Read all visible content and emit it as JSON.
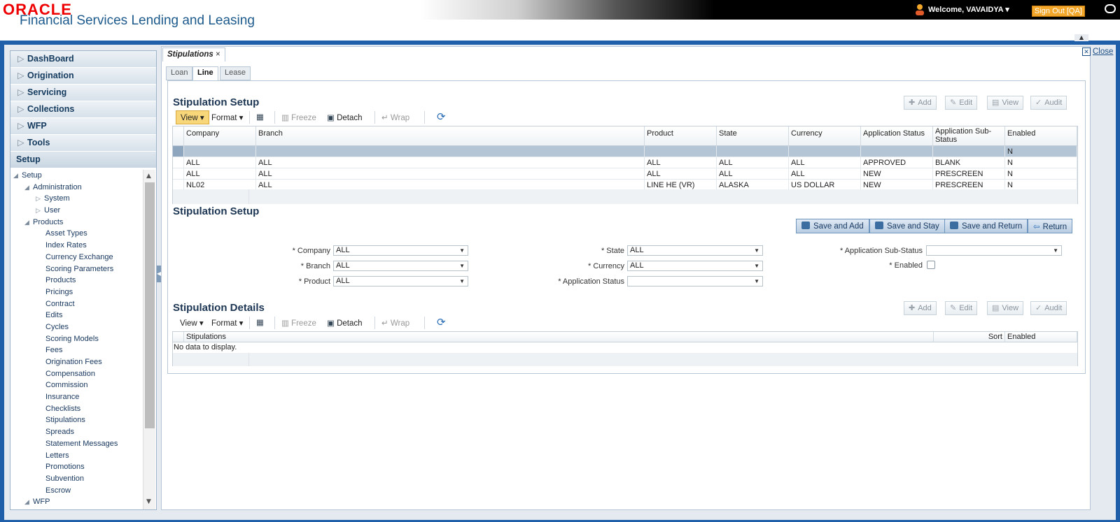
{
  "header": {
    "logo": "ORACLE",
    "product": "Financial Services Lending and Leasing",
    "welcome": "Welcome, VAVAIDYA",
    "signout": "Sign Out [QA]"
  },
  "nav": {
    "items": [
      "DashBoard",
      "Origination",
      "Servicing",
      "Collections",
      "WFP",
      "Tools"
    ],
    "setup": "Setup",
    "tree": [
      {
        "label": "Setup",
        "level": 0,
        "arrow": "◢"
      },
      {
        "label": "Administration",
        "level": 1,
        "arrow": "◢"
      },
      {
        "label": "System",
        "level": 2,
        "arrow": "▷"
      },
      {
        "label": "User",
        "level": 2,
        "arrow": "▷"
      },
      {
        "label": "Products",
        "level": 1,
        "arrow": "◢"
      },
      {
        "label": "Asset Types",
        "level": 3,
        "arrow": ""
      },
      {
        "label": "Index Rates",
        "level": 3,
        "arrow": ""
      },
      {
        "label": "Currency Exchange",
        "level": 3,
        "arrow": ""
      },
      {
        "label": "Scoring Parameters",
        "level": 3,
        "arrow": ""
      },
      {
        "label": "Products",
        "level": 3,
        "arrow": ""
      },
      {
        "label": "Pricings",
        "level": 3,
        "arrow": ""
      },
      {
        "label": "Contract",
        "level": 3,
        "arrow": ""
      },
      {
        "label": "Edits",
        "level": 3,
        "arrow": ""
      },
      {
        "label": "Cycles",
        "level": 3,
        "arrow": ""
      },
      {
        "label": "Scoring Models",
        "level": 3,
        "arrow": ""
      },
      {
        "label": "Fees",
        "level": 3,
        "arrow": ""
      },
      {
        "label": "Origination Fees",
        "level": 3,
        "arrow": ""
      },
      {
        "label": "Compensation",
        "level": 3,
        "arrow": ""
      },
      {
        "label": "Commission",
        "level": 3,
        "arrow": ""
      },
      {
        "label": "Insurance",
        "level": 3,
        "arrow": ""
      },
      {
        "label": "Checklists",
        "level": 3,
        "arrow": ""
      },
      {
        "label": "Stipulations",
        "level": 3,
        "arrow": ""
      },
      {
        "label": "Spreads",
        "level": 3,
        "arrow": ""
      },
      {
        "label": "Statement Messages",
        "level": 3,
        "arrow": ""
      },
      {
        "label": "Letters",
        "level": 3,
        "arrow": ""
      },
      {
        "label": "Promotions",
        "level": 3,
        "arrow": ""
      },
      {
        "label": "Subvention",
        "level": 3,
        "arrow": ""
      },
      {
        "label": "Escrow",
        "level": 3,
        "arrow": ""
      },
      {
        "label": "WFP",
        "level": 1,
        "arrow": "◢"
      }
    ]
  },
  "page": {
    "tab": "Stipulations",
    "close": "Close",
    "subtabs": [
      "Loan",
      "Line",
      "Lease"
    ],
    "active_subtab": "Line"
  },
  "toolbar": {
    "view": "View",
    "format": "Format",
    "freeze": "Freeze",
    "detach": "Detach",
    "wrap": "Wrap",
    "add": "Add",
    "edit": "Edit",
    "view_btn": "View",
    "audit": "Audit"
  },
  "setup_grid": {
    "title": "Stipulation Setup",
    "columns": [
      "Company",
      "Branch",
      "Product",
      "State",
      "Currency",
      "Application Status",
      "Application Sub-Status",
      "Enabled"
    ],
    "rows": [
      [
        "",
        "",
        "",
        "",
        "",
        "",
        "",
        "N"
      ],
      [
        "ALL",
        "ALL",
        "ALL",
        "ALL",
        "ALL",
        "APPROVED",
        "BLANK",
        "N"
      ],
      [
        "ALL",
        "ALL",
        "ALL",
        "ALL",
        "ALL",
        "NEW",
        "PRESCREEN",
        "N"
      ],
      [
        "NL02",
        "ALL",
        "LINE HE (VR)",
        "ALASKA",
        "US DOLLAR",
        "NEW",
        "PRESCREEN",
        "N"
      ]
    ]
  },
  "form": {
    "title": "Stipulation Setup",
    "buttons": [
      "Save and Add",
      "Save and Stay",
      "Save and Return",
      "Return"
    ],
    "fields": {
      "company": {
        "label": "* Company",
        "value": "ALL"
      },
      "branch": {
        "label": "* Branch",
        "value": "ALL"
      },
      "product": {
        "label": "* Product",
        "value": "ALL"
      },
      "state": {
        "label": "* State",
        "value": "ALL"
      },
      "currency": {
        "label": "* Currency",
        "value": "ALL"
      },
      "app_status": {
        "label": "* Application Status",
        "value": ""
      },
      "app_sub_status": {
        "label": "* Application Sub-Status",
        "value": ""
      },
      "enabled": {
        "label": "* Enabled"
      }
    }
  },
  "details": {
    "title": "Stipulation Details",
    "columns": [
      "Stipulations",
      "Sort",
      "Enabled"
    ],
    "empty": "No data to display."
  }
}
